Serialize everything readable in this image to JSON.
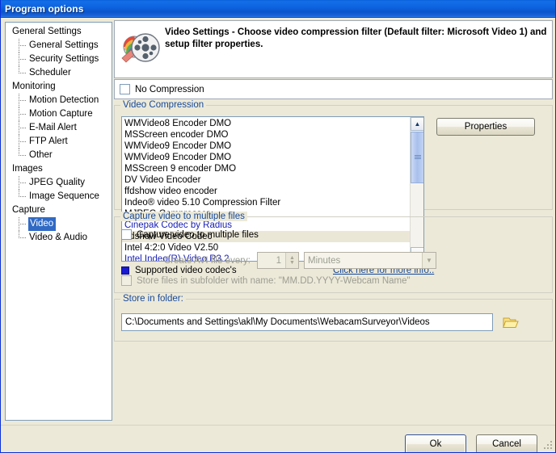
{
  "window": {
    "title": "Program options"
  },
  "sidebar": {
    "items": [
      {
        "label": "General Settings",
        "level": 0,
        "selected": false,
        "last": false
      },
      {
        "label": "General Settings",
        "level": 1,
        "selected": false,
        "last": false
      },
      {
        "label": "Security Settings",
        "level": 1,
        "selected": false,
        "last": false
      },
      {
        "label": "Scheduler",
        "level": 1,
        "selected": false,
        "last": true
      },
      {
        "label": "Monitoring",
        "level": 0,
        "selected": false,
        "last": false
      },
      {
        "label": "Motion Detection",
        "level": 1,
        "selected": false,
        "last": false
      },
      {
        "label": "Motion Capture",
        "level": 1,
        "selected": false,
        "last": false
      },
      {
        "label": "E-Mail Alert",
        "level": 1,
        "selected": false,
        "last": false
      },
      {
        "label": "FTP Alert",
        "level": 1,
        "selected": false,
        "last": false
      },
      {
        "label": "Other",
        "level": 1,
        "selected": false,
        "last": true
      },
      {
        "label": "Images",
        "level": 0,
        "selected": false,
        "last": false
      },
      {
        "label": "JPEG Quality",
        "level": 1,
        "selected": false,
        "last": false
      },
      {
        "label": "Image Sequence",
        "level": 1,
        "selected": false,
        "last": true
      },
      {
        "label": "Capture",
        "level": 0,
        "selected": false,
        "last": false
      },
      {
        "label": "Video",
        "level": 1,
        "selected": true,
        "last": false
      },
      {
        "label": "Video & Audio",
        "level": 1,
        "selected": false,
        "last": true
      }
    ]
  },
  "header": {
    "icon": "film-reel-icon",
    "text": "Video Settings - Choose video compression filter (Default filter: Microsoft Video 1) and setup filter properties."
  },
  "no_compression": {
    "label": "No Compression",
    "checked": false
  },
  "compression_group": {
    "legend": "Video Compression",
    "properties_button": "Properties",
    "supported_legend": "Supported video codec's",
    "more_info_link": "Click here for more info..",
    "codecs": [
      {
        "name": "WMVideo8 Encoder DMO",
        "supported": false,
        "highlighted": false
      },
      {
        "name": "MSScreen encoder DMO",
        "supported": false,
        "highlighted": false
      },
      {
        "name": "WMVideo9 Encoder DMO",
        "supported": false,
        "highlighted": false
      },
      {
        "name": "WMVideo9 Encoder DMO",
        "supported": false,
        "highlighted": false
      },
      {
        "name": "MSScreen 9 encoder DMO",
        "supported": false,
        "highlighted": false
      },
      {
        "name": "DV Video Encoder",
        "supported": false,
        "highlighted": false
      },
      {
        "name": "ffdshow video encoder",
        "supported": false,
        "highlighted": false
      },
      {
        "name": "Indeo® video 5.10 Compression Filter",
        "supported": false,
        "highlighted": false
      },
      {
        "name": "MJPEG Compressor",
        "supported": false,
        "highlighted": false
      },
      {
        "name": "Cinepak Codec by Radius",
        "supported": true,
        "highlighted": false
      },
      {
        "name": "ffdshow Video Codec",
        "supported": false,
        "highlighted": true
      },
      {
        "name": "Intel 4:2:0 Video V2.50",
        "supported": false,
        "highlighted": false
      },
      {
        "name": "Intel Indeo(R) Video R3.2",
        "supported": true,
        "highlighted": false
      }
    ]
  },
  "multi_files_group": {
    "legend": "Capture video to multiple files",
    "checkbox_label": "Capture video to multiple files",
    "checkbox_checked": false,
    "interval_label": "Create AVI file every:",
    "interval_value": "1",
    "interval_unit": "Minutes",
    "subfolder_label": "Store files in subfolder with name: \"MM.DD.YYYY-Webcam Name\"",
    "subfolder_checked": false
  },
  "folder_group": {
    "legend": "Store in folder:",
    "path": "C:\\Documents and Settings\\akl\\My Documents\\WebacamSurveyor\\Videos",
    "browse_icon": "open-folder-icon"
  },
  "footer": {
    "ok_label": "Ok",
    "cancel_label": "Cancel"
  },
  "colors": {
    "titlebar_blue": "#0a5fd8",
    "selection_blue": "#316ac5",
    "group_label_blue": "#16499c",
    "supported_codec_blue": "#1a20b6",
    "dialog_face": "#ece9d8",
    "highlight_row": "#ebe7d7"
  }
}
